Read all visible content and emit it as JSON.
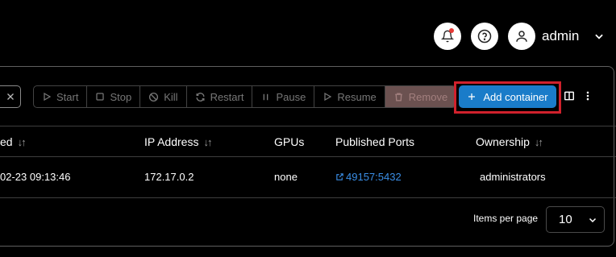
{
  "header": {
    "user_name": "admin",
    "notification_icon": "bell-icon",
    "help_icon": "help-circle-icon",
    "avatar_icon": "user-icon"
  },
  "toolbar": {
    "actions": [
      {
        "label": "Start",
        "icon": "play-icon"
      },
      {
        "label": "Stop",
        "icon": "stop-icon"
      },
      {
        "label": "Kill",
        "icon": "ban-icon"
      },
      {
        "label": "Restart",
        "icon": "refresh-icon"
      },
      {
        "label": "Pause",
        "icon": "pause-icon"
      },
      {
        "label": "Resume",
        "icon": "play-icon"
      },
      {
        "label": "Remove",
        "icon": "trash-icon"
      }
    ],
    "add_label": "Add container",
    "colors": {
      "accent": "#1a7cc9",
      "highlight": "#d0212c",
      "link": "#3a8ee6"
    }
  },
  "table": {
    "columns": {
      "created": "ed",
      "ip": "IP Address",
      "gpus": "GPUs",
      "ports": "Published Ports",
      "ownership": "Ownership"
    },
    "sort_glyph": "↓↑",
    "row": {
      "created": "02-23 09:13:46",
      "ip": "172.17.0.2",
      "gpus": "none",
      "ports": "49157:5432",
      "ownership": "administrators"
    }
  },
  "pagination": {
    "items_per_page_label": "Items per page",
    "items_per_page": "10"
  }
}
